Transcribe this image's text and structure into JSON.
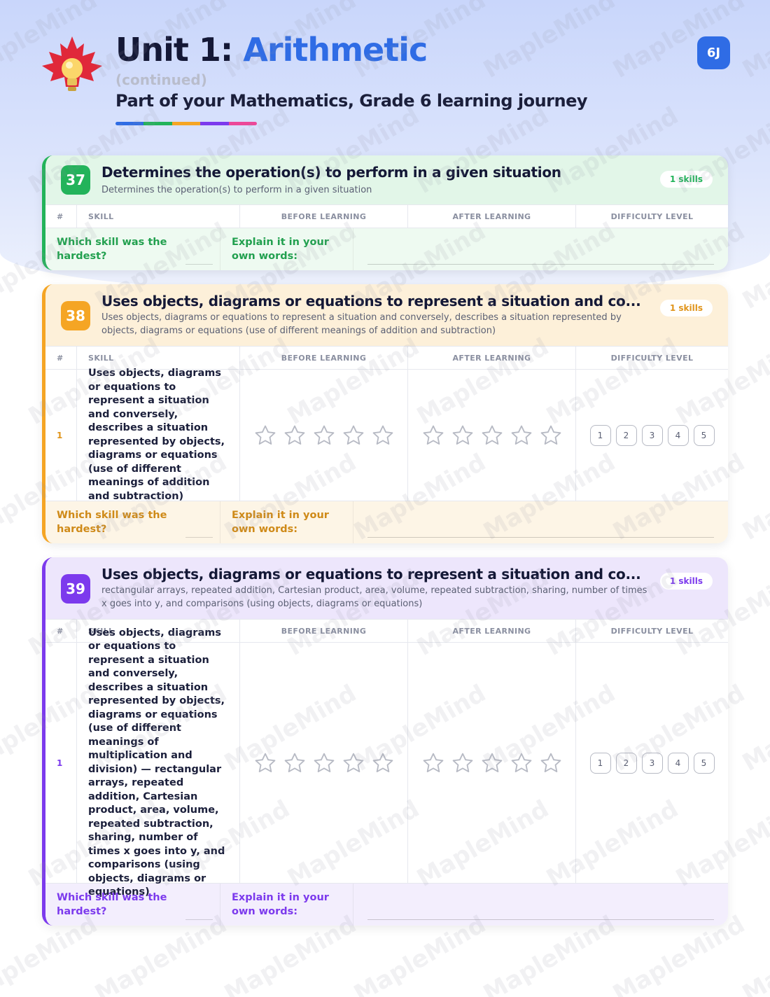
{
  "header": {
    "title_prefix": "Unit 1: ",
    "title_accent": "Arithmetic",
    "continued": "(continued)",
    "subtitle": "Part of your Mathematics, Grade 6 learning journey",
    "grade_badge": "6J",
    "accent_color": "#2f6ce5",
    "rainbow_colors": [
      "#2f6ce5",
      "#22b35a",
      "#f5a524",
      "#7c3aed",
      "#ec4899"
    ]
  },
  "watermark": "MapleMind",
  "columns": {
    "num": "#",
    "skill": "SKILL",
    "before": "BEFORE LEARNING",
    "after": "AFTER LEARNING",
    "difficulty": "DIFFICULTY LEVEL"
  },
  "footer": {
    "question": "Which skill was the hardest?",
    "explain": "Explain it in your own words:"
  },
  "difficulty_levels": [
    "1",
    "2",
    "3",
    "4",
    "5"
  ],
  "stars_count": 5,
  "cards": [
    {
      "number": "37",
      "color": "#22b35a",
      "title": "Determines the operation(s) to perform in a given situation",
      "description": "Determines the operation(s) to perform in a given situation",
      "skills_count": "1 skills",
      "rows": []
    },
    {
      "number": "38",
      "color": "#f5a524",
      "title": "Uses objects, diagrams or equations to represent a situation and co...",
      "description": "Uses objects, diagrams or equations to represent a situation and conversely, describes a situation represented by objects, diagrams or equations (use of different meanings of addition and subtraction)",
      "skills_count": "1 skills",
      "rows": [
        {
          "num": "1",
          "skill": "Uses objects, diagrams or equations to represent a situation and conversely, describes a situation represented by objects, diagrams or equations (use of different meanings of addition and subtraction)"
        }
      ]
    },
    {
      "number": "39",
      "color": "#7c3aed",
      "title": "Uses objects, diagrams or equations to represent a situation and co...",
      "description": "rectangular arrays, repeated addition, Cartesian product, area, volume, repeated subtraction, sharing, number of times x goes into y, and comparisons (using objects, diagrams or equations)",
      "skills_count": "1 skills",
      "rows": [
        {
          "num": "1",
          "skill": "Uses objects, diagrams or equations to represent a situation and conversely, describes a situation represented by objects, diagrams or equations (use of different meanings of multiplication and division) — rectangular arrays, repeated addition, Cartesian product, area, volume, repeated subtraction, sharing, number of times x goes into y, and comparisons (using objects, diagrams or equations)"
        }
      ]
    }
  ]
}
